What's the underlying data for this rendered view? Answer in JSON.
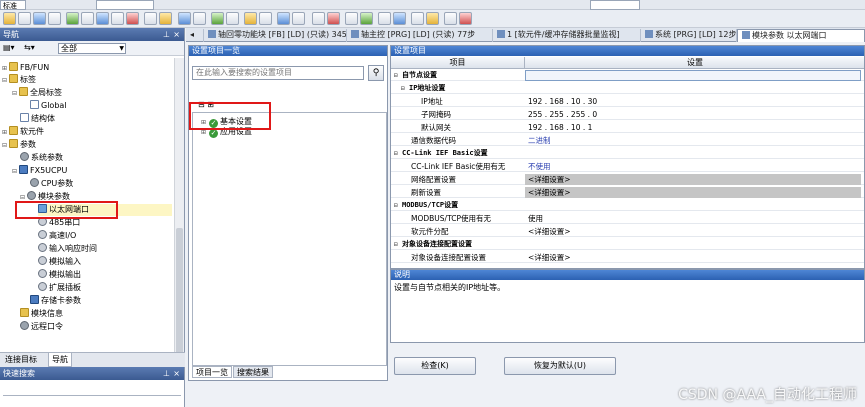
{
  "toolbar": {
    "file_label": "标准"
  },
  "nav": {
    "title": "导航",
    "filter_selected": "全部",
    "tree": [
      {
        "label": "FB/FUN",
        "level": 0
      },
      {
        "label": "标签",
        "level": 0
      },
      {
        "label": "全局标签",
        "level": 1
      },
      {
        "label": "Global",
        "level": 2
      },
      {
        "label": "结构体",
        "level": 1
      },
      {
        "label": "软元件",
        "level": 0
      },
      {
        "label": "参数",
        "level": 0
      },
      {
        "label": "系统参数",
        "level": 1
      },
      {
        "label": "FX5UCPU",
        "level": 1
      },
      {
        "label": "CPU参数",
        "level": 2
      },
      {
        "label": "模块参数",
        "level": 2
      },
      {
        "label": "以太网端口",
        "level": 3
      },
      {
        "label": "485串口",
        "level": 3
      },
      {
        "label": "高速I/O",
        "level": 3
      },
      {
        "label": "输入响应时间",
        "level": 3
      },
      {
        "label": "模拟输入",
        "level": 3
      },
      {
        "label": "模拟输出",
        "level": 3
      },
      {
        "label": "扩展插板",
        "level": 3
      },
      {
        "label": "存储卡参数",
        "level": 2
      },
      {
        "label": "模块信息",
        "level": 1
      },
      {
        "label": "远程口令",
        "level": 1
      }
    ],
    "tabs": [
      "连接目标",
      "导航"
    ]
  },
  "search_panel": {
    "title": "快速搜索"
  },
  "doc_tabs": [
    {
      "label": "轴回零功能块 [FB] [LD] (只读) 345..."
    },
    {
      "label": "轴主控 [PRG] [LD] (只读) 77步"
    },
    {
      "label": "1 [软元件/缓冲存储器批量监视]"
    },
    {
      "label": "系统 [PRG] [LD] 12步"
    },
    {
      "label": "模块参数 以太网端口"
    }
  ],
  "list_panel": {
    "title": "设置项目一览",
    "search_placeholder": "在此输入要搜索的设置项目",
    "items": [
      {
        "label": "基本设置"
      },
      {
        "label": "应用设置"
      }
    ],
    "tabs": [
      "项目一览",
      "搜索结果"
    ]
  },
  "grid_panel": {
    "title": "设置项目",
    "col_item": "项目",
    "col_setting": "设置",
    "rows": [
      {
        "item": "自节点设置",
        "value": "",
        "type": "grp0"
      },
      {
        "item": "IP地址设置",
        "value": "",
        "type": "grp1"
      },
      {
        "item": "IP地址",
        "value": "192 . 168 . 10 . 30",
        "type": "leaf"
      },
      {
        "item": "子网掩码",
        "value": "255 . 255 . 255 . 0",
        "type": "leaf"
      },
      {
        "item": "默认网关",
        "value": "192 . 168 . 10 . 1",
        "type": "leaf"
      },
      {
        "item": "通信数据代码",
        "value": "二进制",
        "type": "leaf1",
        "style": "blue"
      },
      {
        "item": "CC-Link IEF Basic设置",
        "value": "",
        "type": "grp0"
      },
      {
        "item": "CC-Link IEF Basic使用有无",
        "value": "不使用",
        "type": "leaf1",
        "style": "blue"
      },
      {
        "item": "网络配置设置",
        "value": "<详细设置>",
        "type": "leaf1",
        "style": "gray"
      },
      {
        "item": "刷新设置",
        "value": "<详细设置>",
        "type": "leaf1",
        "style": "gray"
      },
      {
        "item": "MODBUS/TCP设置",
        "value": "",
        "type": "grp0"
      },
      {
        "item": "MODBUS/TCP使用有无",
        "value": "使用",
        "type": "leaf1"
      },
      {
        "item": "软元件分配",
        "value": "<详细设置>",
        "type": "leaf1"
      },
      {
        "item": "对象设备连接配置设置",
        "value": "",
        "type": "grp0"
      },
      {
        "item": "对象设备连接配置设置",
        "value": "<详细设置>",
        "type": "leaf1"
      }
    ]
  },
  "desc_panel": {
    "title": "说明",
    "text": "设置与自节点相关的IP地址等。"
  },
  "buttons": {
    "check": "检查(K)",
    "restore": "恢复为默认(U)"
  },
  "watermark": "CSDN @AAA_自动化工程师",
  "colors": {
    "title_blue": "#2c61b2",
    "highlight_red": "#e01818",
    "nav_selected": "#fdf6c4"
  }
}
